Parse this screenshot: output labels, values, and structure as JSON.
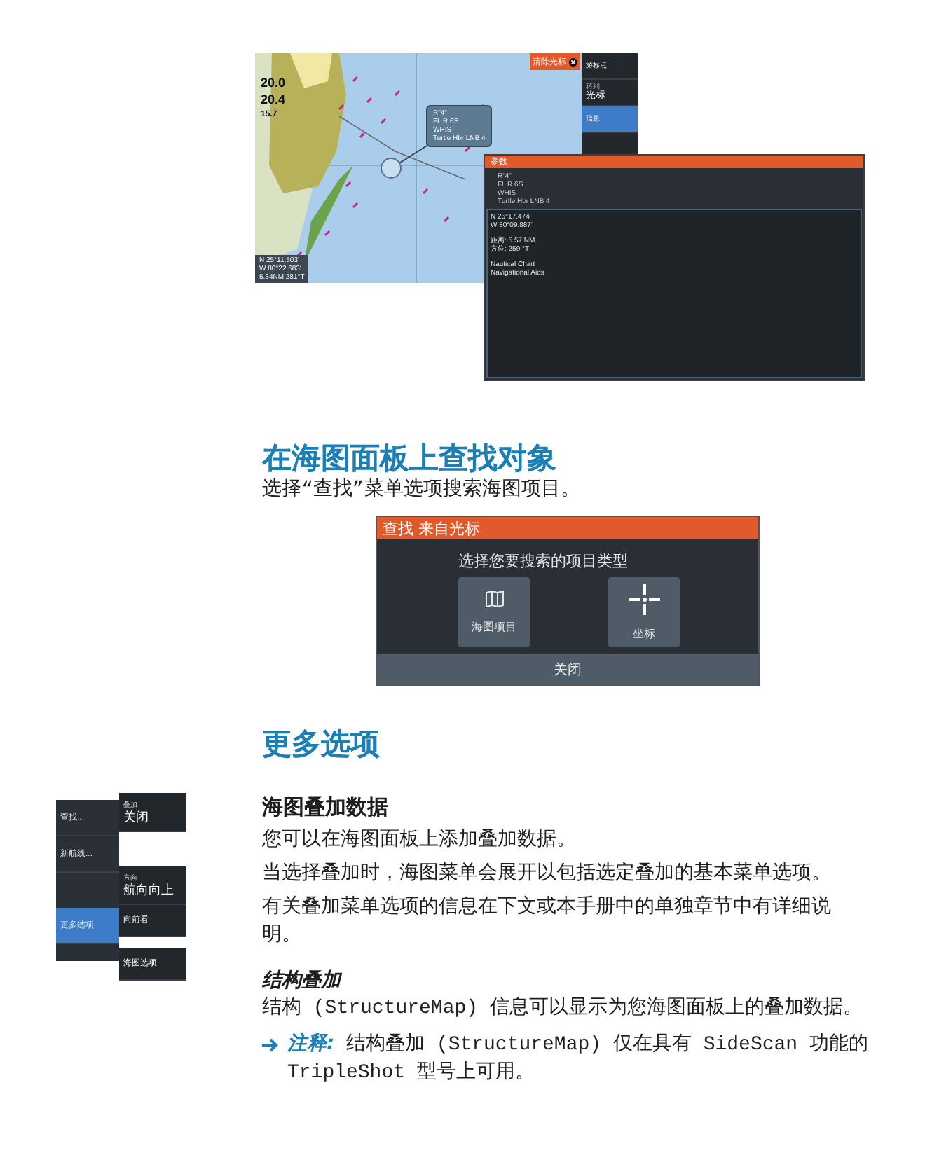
{
  "chart_screenshot": {
    "clear_cursor_button": "清除光标",
    "depths": [
      "20.0",
      "20.4",
      "15.7"
    ],
    "callout": [
      "R\"4\"",
      "FL R 6S",
      "WHIS",
      "Turtle Hbr LNB 4"
    ],
    "position_readout": [
      "N 25°11.503'",
      "W 80°22.683'",
      "5.34NM 281°T"
    ],
    "menu": [
      {
        "label": "游标点...",
        "selected": false
      },
      {
        "caption": "转到",
        "label": "光标",
        "selected": false
      },
      {
        "label": "信息",
        "selected": true
      }
    ],
    "info_panel": {
      "title": "参数",
      "object_lines": [
        "R\"4\"",
        "FL R 6S",
        "WHIS",
        "Turtle Hbr LNB 4"
      ],
      "detail_groups": [
        [
          "N 25°17.474'",
          "W 80°09.887'"
        ],
        [
          "距离: 5.57 NM",
          "方位: 259 °T"
        ],
        [
          "Nautical Chart",
          "Navigational Aids"
        ]
      ]
    }
  },
  "find_section": {
    "heading": "在海图面板上查找对象",
    "text": "选择“查找”菜单选项搜索海图项目。",
    "dialog": {
      "title": "查找 来自光标",
      "prompt": "选择您要搜索的项目类型",
      "options": [
        {
          "kind": "map",
          "label": "海图项目"
        },
        {
          "kind": "crosshair",
          "label": "坐标"
        }
      ],
      "close_button": "关闭"
    }
  },
  "more_section": {
    "heading": "更多选项",
    "menu_screenshot": {
      "main_items": [
        {
          "label": "查找...",
          "selected": false
        },
        {
          "label": "新航线...",
          "selected": false
        },
        {
          "label": "更多选项",
          "selected": true
        }
      ],
      "sub_items": [
        {
          "caption": "叠加",
          "label": "关闭"
        },
        {
          "caption": "方向",
          "label": "航向向上"
        },
        {
          "label": "向前看"
        },
        {
          "label": "海图选项"
        }
      ]
    },
    "subheading": "海图叠加数据",
    "paragraphs": [
      "您可以在海图面板上添加叠加数据。",
      "当选择叠加时，海图菜单会展开以包括选定叠加的基本菜单选项。",
      "有关叠加菜单选项的信息在下文或本手册中的单独章节中有详细说明。"
    ],
    "structure": {
      "heading": "结构叠加",
      "text": "结构 (StructureMap) 信息可以显示为您海图面板上的叠加数据。",
      "note": {
        "label": "注释:",
        "text": "结构叠加 (StructureMap) 仅在具有 SideScan 功能的 TripleShot 型号上可用。"
      }
    }
  }
}
